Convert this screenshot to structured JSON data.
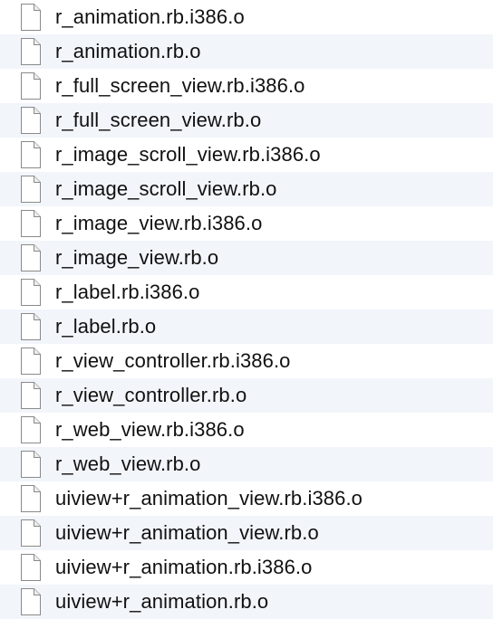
{
  "file_list": {
    "icon": "document-icon",
    "row_colors": {
      "odd": "#ffffff",
      "even": "#f2f5fa"
    },
    "files": [
      "r_animation.rb.i386.o",
      "r_animation.rb.o",
      "r_full_screen_view.rb.i386.o",
      "r_full_screen_view.rb.o",
      "r_image_scroll_view.rb.i386.o",
      "r_image_scroll_view.rb.o",
      "r_image_view.rb.i386.o",
      "r_image_view.rb.o",
      "r_label.rb.i386.o",
      "r_label.rb.o",
      "r_view_controller.rb.i386.o",
      "r_view_controller.rb.o",
      "r_web_view.rb.i386.o",
      "r_web_view.rb.o",
      "uiview+r_animation_view.rb.i386.o",
      "uiview+r_animation_view.rb.o",
      "uiview+r_animation.rb.i386.o",
      "uiview+r_animation.rb.o"
    ]
  }
}
